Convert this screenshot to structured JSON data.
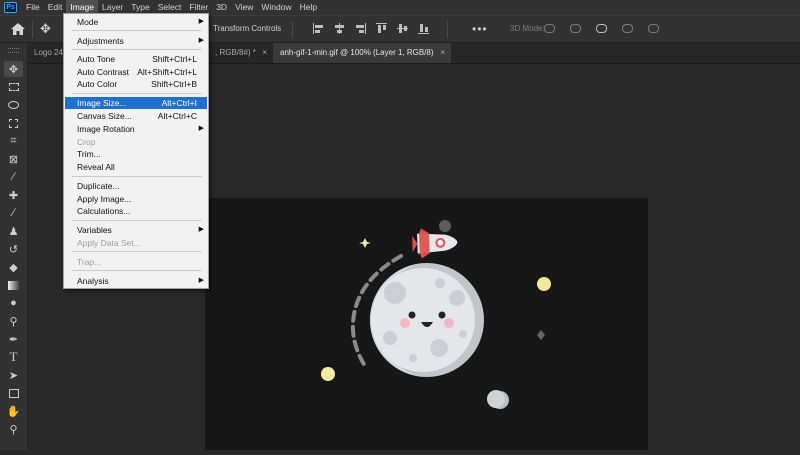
{
  "app": {
    "logo_text": "Ps"
  },
  "menubar": {
    "items": [
      "File",
      "Edit",
      "Image",
      "Layer",
      "Type",
      "Select",
      "Filter",
      "3D",
      "View",
      "Window",
      "Help"
    ],
    "active": "Image"
  },
  "options_bar": {
    "transform_controls_label": "Transform Controls",
    "mode_3d_label": "3D Mode:",
    "more_label": "•••"
  },
  "tabs": [
    {
      "label": "Logo 24",
      "close": "×",
      "active": false
    },
    {
      "label": ", RGB/8#) *",
      "close": "×",
      "active": false
    },
    {
      "label": "anh-gif-1-min.gif @ 100% (Layer 1, RGB/8)",
      "close": "×",
      "active": true
    }
  ],
  "image_menu": {
    "items": [
      {
        "label": "Mode",
        "shortcut": "",
        "submenu": true,
        "disabled": false,
        "highlight": false
      },
      {
        "label": "Adjustments",
        "shortcut": "",
        "submenu": true,
        "disabled": false,
        "highlight": false
      },
      {
        "label": "Auto Tone",
        "shortcut": "Shift+Ctrl+L",
        "submenu": false,
        "disabled": false,
        "highlight": false
      },
      {
        "label": "Auto Contrast",
        "shortcut": "Alt+Shift+Ctrl+L",
        "submenu": false,
        "disabled": false,
        "highlight": false
      },
      {
        "label": "Auto Color",
        "shortcut": "Shift+Ctrl+B",
        "submenu": false,
        "disabled": false,
        "highlight": false
      },
      {
        "label": "Image Size...",
        "shortcut": "Alt+Ctrl+I",
        "submenu": false,
        "disabled": false,
        "highlight": true
      },
      {
        "label": "Canvas Size...",
        "shortcut": "Alt+Ctrl+C",
        "submenu": false,
        "disabled": false,
        "highlight": false
      },
      {
        "label": "Image Rotation",
        "shortcut": "",
        "submenu": true,
        "disabled": false,
        "highlight": false
      },
      {
        "label": "Crop",
        "shortcut": "",
        "submenu": false,
        "disabled": true,
        "highlight": false
      },
      {
        "label": "Trim...",
        "shortcut": "",
        "submenu": false,
        "disabled": false,
        "highlight": false
      },
      {
        "label": "Reveal All",
        "shortcut": "",
        "submenu": false,
        "disabled": false,
        "highlight": false
      },
      {
        "label": "Duplicate...",
        "shortcut": "",
        "submenu": false,
        "disabled": false,
        "highlight": false
      },
      {
        "label": "Apply Image...",
        "shortcut": "",
        "submenu": false,
        "disabled": false,
        "highlight": false
      },
      {
        "label": "Calculations...",
        "shortcut": "",
        "submenu": false,
        "disabled": false,
        "highlight": false
      },
      {
        "label": "Variables",
        "shortcut": "",
        "submenu": true,
        "disabled": false,
        "highlight": false
      },
      {
        "label": "Apply Data Set...",
        "shortcut": "",
        "submenu": false,
        "disabled": true,
        "highlight": false
      },
      {
        "label": "Trap...",
        "shortcut": "",
        "submenu": false,
        "disabled": true,
        "highlight": false
      },
      {
        "label": "Analysis",
        "shortcut": "",
        "submenu": true,
        "disabled": false,
        "highlight": false
      }
    ],
    "submenu_arrow": "▶"
  },
  "colors": {
    "accent": "#1f6fd0",
    "canvas_bg": "#171717",
    "ui_bg": "#323232",
    "moon": "#e4e6ea",
    "rocket": "#e05a5a"
  },
  "icons": {
    "home": "home-icon",
    "move": "move-icon",
    "tools": [
      "move-tool-icon",
      "marquee-tool-icon",
      "lasso-tool-icon",
      "object-select-tool-icon",
      "crop-tool-icon",
      "frame-tool-icon",
      "eyedropper-tool-icon",
      "healing-brush-tool-icon",
      "brush-tool-icon",
      "clone-stamp-tool-icon",
      "history-brush-tool-icon",
      "eraser-tool-icon",
      "gradient-tool-icon",
      "blur-tool-icon",
      "dodge-tool-icon",
      "pen-tool-icon",
      "type-tool-icon",
      "path-select-tool-icon",
      "rectangle-tool-icon",
      "hand-tool-icon",
      "zoom-tool-icon"
    ]
  }
}
